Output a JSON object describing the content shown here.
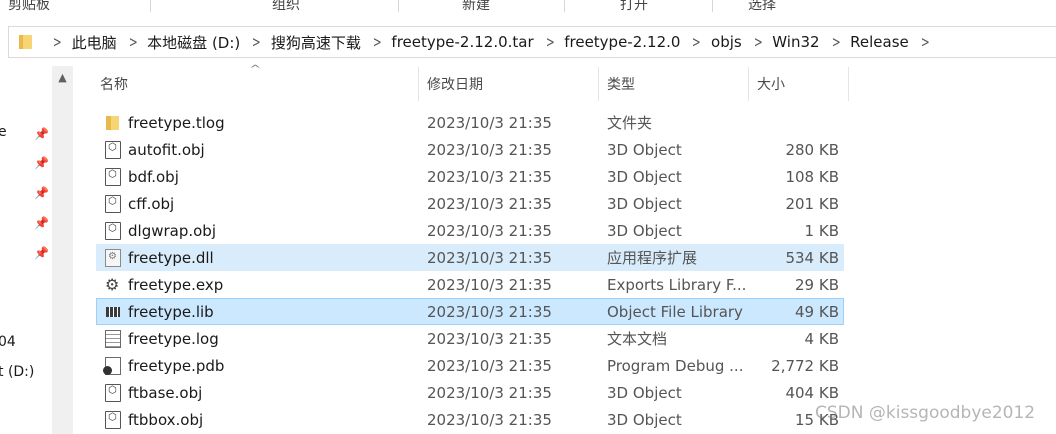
{
  "ribbon": {
    "groups": [
      "剪贴板",
      "组织",
      "新建",
      "打开",
      "选择"
    ]
  },
  "address": {
    "crumbs": [
      "此电脑",
      "本地磁盘 (D:)",
      "搜狗高速下载",
      "freetype-2.12.0.tar",
      "freetype-2.12.0",
      "objs",
      "Win32",
      "Release"
    ]
  },
  "nav": {
    "items": [
      "e",
      "04",
      "t (D:)"
    ]
  },
  "columns": {
    "name": "名称",
    "date": "修改日期",
    "type": "类型",
    "size": "大小"
  },
  "files": [
    {
      "name": "freetype.tlog",
      "date": "2023/10/3 21:35",
      "type": "文件夹",
      "size": "",
      "icon": "folder-icon"
    },
    {
      "name": "autofit.obj",
      "date": "2023/10/3 21:35",
      "type": "3D Object",
      "size": "280 KB",
      "icon": "3d-object-icon"
    },
    {
      "name": "bdf.obj",
      "date": "2023/10/3 21:35",
      "type": "3D Object",
      "size": "108 KB",
      "icon": "3d-object-icon"
    },
    {
      "name": "cff.obj",
      "date": "2023/10/3 21:35",
      "type": "3D Object",
      "size": "201 KB",
      "icon": "3d-object-icon"
    },
    {
      "name": "dlgwrap.obj",
      "date": "2023/10/3 21:35",
      "type": "3D Object",
      "size": "1 KB",
      "icon": "3d-object-icon"
    },
    {
      "name": "freetype.dll",
      "date": "2023/10/3 21:35",
      "type": "应用程序扩展",
      "size": "534 KB",
      "icon": "dll-icon"
    },
    {
      "name": "freetype.exp",
      "date": "2023/10/3 21:35",
      "type": "Exports Library F...",
      "size": "29 KB",
      "icon": "exp-icon"
    },
    {
      "name": "freetype.lib",
      "date": "2023/10/3 21:35",
      "type": "Object File Library",
      "size": "49 KB",
      "icon": "lib-icon"
    },
    {
      "name": "freetype.log",
      "date": "2023/10/3 21:35",
      "type": "文本文档",
      "size": "4 KB",
      "icon": "text-file-icon"
    },
    {
      "name": "freetype.pdb",
      "date": "2023/10/3 21:35",
      "type": "Program Debug ...",
      "size": "2,772 KB",
      "icon": "pdb-icon"
    },
    {
      "name": "ftbase.obj",
      "date": "2023/10/3 21:35",
      "type": "3D Object",
      "size": "404 KB",
      "icon": "3d-object-icon"
    },
    {
      "name": "ftbbox.obj",
      "date": "2023/10/3 21:35",
      "type": "3D Object",
      "size": "15 KB",
      "icon": "3d-object-icon"
    }
  ],
  "watermark": "CSDN @kissgoodbye2012",
  "colors": {
    "selection": "#cce8ff",
    "selection_border": "#99d1ff",
    "folder": "#f7d575"
  }
}
